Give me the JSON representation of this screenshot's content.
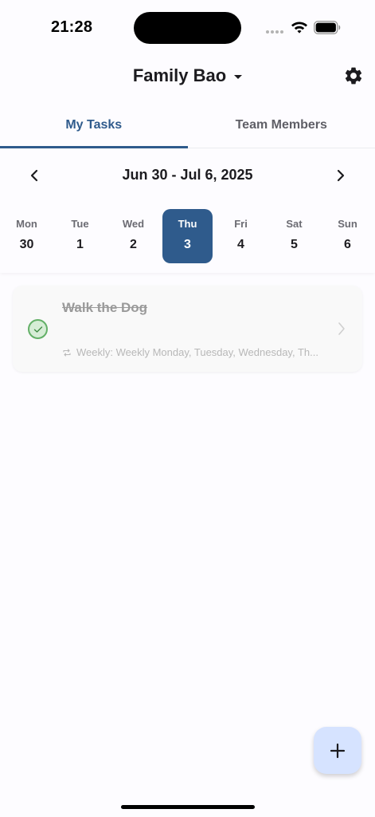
{
  "status_bar": {
    "time": "21:28"
  },
  "header": {
    "title": "Family Bao",
    "dropdown_icon": "caret-down-icon",
    "settings_icon": "gear-icon"
  },
  "tabs": [
    {
      "label": "My Tasks",
      "active": true
    },
    {
      "label": "Team Members",
      "active": false
    }
  ],
  "week": {
    "range": "Jun 30 - Jul 6, 2025",
    "prev_icon": "chevron-left-icon",
    "next_icon": "chevron-right-icon",
    "days": [
      {
        "dow": "Mon",
        "num": "30",
        "selected": false
      },
      {
        "dow": "Tue",
        "num": "1",
        "selected": false
      },
      {
        "dow": "Wed",
        "num": "2",
        "selected": false
      },
      {
        "dow": "Thu",
        "num": "3",
        "selected": true
      },
      {
        "dow": "Fri",
        "num": "4",
        "selected": false
      },
      {
        "dow": "Sat",
        "num": "5",
        "selected": false
      },
      {
        "dow": "Sun",
        "num": "6",
        "selected": false
      }
    ]
  },
  "tasks": [
    {
      "title": "Walk the Dog",
      "completed": true,
      "recurrence": "Weekly: Weekly Monday, Tuesday, Wednesday, Th..."
    }
  ],
  "fab": {
    "icon": "plus-icon"
  },
  "colors": {
    "primary": "#2f5b8c",
    "fab_bg": "#d6e3ff",
    "complete_green": "#63b067",
    "complete_bg": "#d6edd6"
  }
}
